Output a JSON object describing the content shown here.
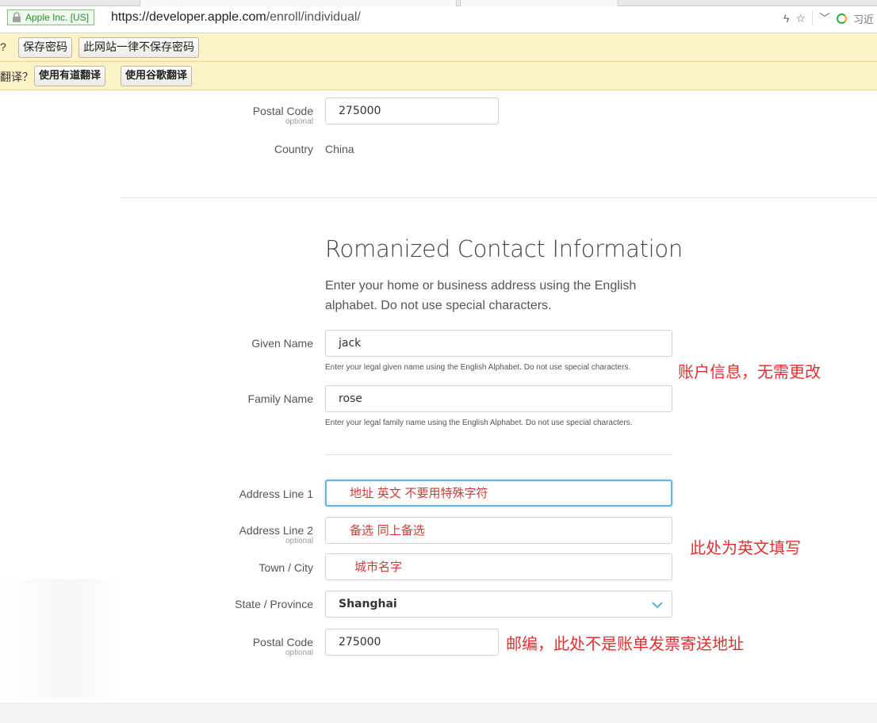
{
  "browser": {
    "ev_badge": "Apple Inc. [US]",
    "url_host": "https://developer.apple.com",
    "url_path": "/enroll/individual/",
    "right_clip": "习近"
  },
  "password_bar": {
    "lead": "?",
    "save_label": "保存密码",
    "never_label": "此网站一律不保存密码"
  },
  "translate_bar": {
    "lead": "翻译？",
    "youdao_label": "使用有道翻译",
    "google_label": "使用谷歌翻译"
  },
  "address_top": {
    "postal_label": "Postal Code",
    "postal_optional": "optional",
    "postal_value": "275000",
    "country_label": "Country",
    "country_value": "China"
  },
  "romanized": {
    "title": "Romanized Contact Information",
    "description": "Enter your home or business address using the English alphabet. Do not use special characters.",
    "given_name_label": "Given Name",
    "given_name_value": "jack",
    "given_name_hint": "Enter your legal given name using the English Alphabet. Do not use special characters.",
    "family_name_label": "Family Name",
    "family_name_value": "rose",
    "family_name_hint": "Enter your legal family name using the English Alphabet. Do not use special characters.",
    "address1_label": "Address Line 1",
    "address1_value": "地址   英文   不要用特殊字符",
    "address2_label": "Address Line 2",
    "address2_optional": "optional",
    "address2_value": "备选   同上备选",
    "city_label": "Town / City",
    "city_value": "城市名字",
    "state_label": "State / Province",
    "state_value": "Shanghai",
    "postal_label": "Postal Code",
    "postal_optional": "optional",
    "postal_value": "275000"
  },
  "annotations": {
    "account_note": "账户信息，无需更改",
    "english_note": "此处为英文填写",
    "postal_note": "邮编，此处不是账单发票寄送地址"
  },
  "colors": {
    "annotation": "#e0302f",
    "focus_border": "#66b5e0",
    "infobar_bg": "#fdf3c8"
  }
}
